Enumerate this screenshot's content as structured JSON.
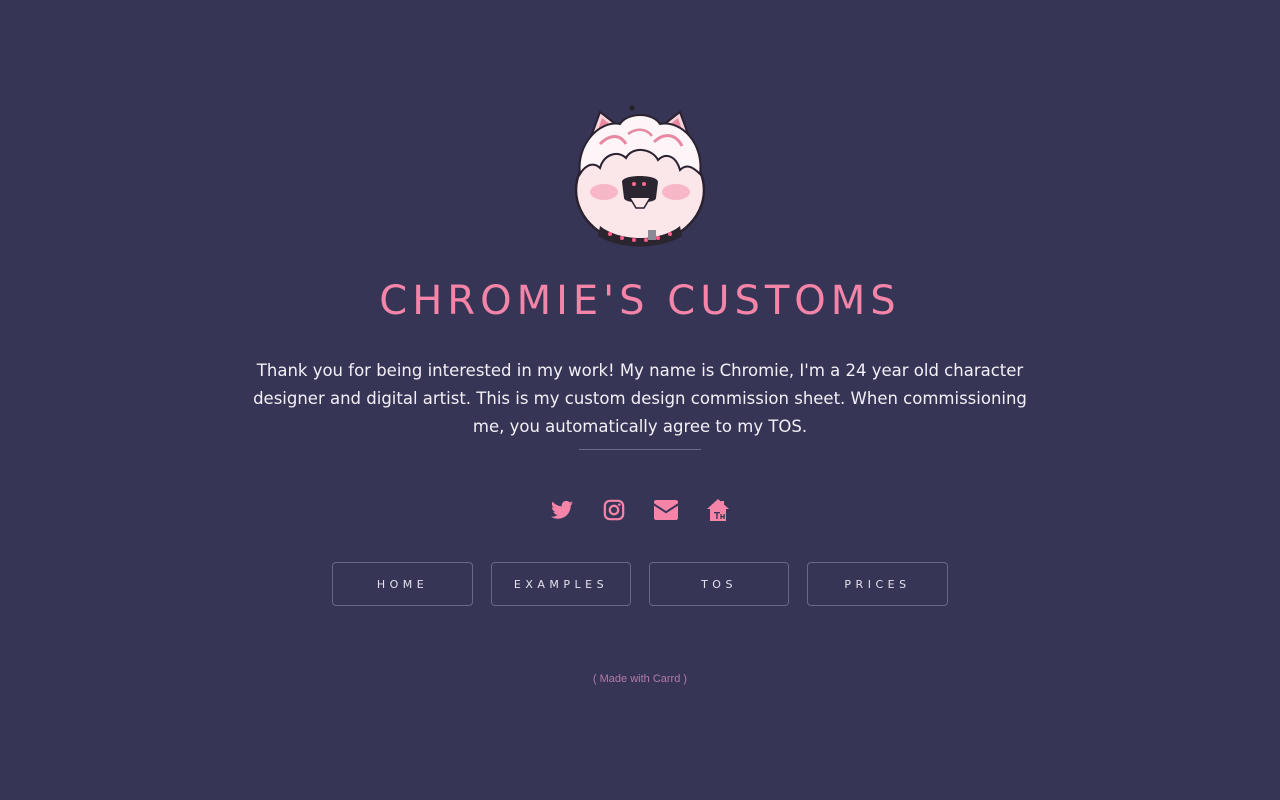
{
  "site": {
    "title": "CHROMIE'S CUSTOMS",
    "intro": "Thank you for being interested in my work! My name is Chromie, I'm a 24 year old character designer and digital artist. This is my custom design commission sheet. When commissioning me, you automatically agree to my TOS."
  },
  "social": [
    {
      "icon": "twitter-icon"
    },
    {
      "icon": "instagram-icon"
    },
    {
      "icon": "envelope-icon"
    },
    {
      "icon": "toyhouse-icon"
    }
  ],
  "nav": {
    "home": "HOME",
    "examples": "EXAMPLES",
    "tos": "TOS",
    "prices": "PRICES"
  },
  "footer": {
    "label": "( Made with Carrd )"
  },
  "colors": {
    "background": "#373556",
    "accent": "#f585a8",
    "text": "#f3eff7",
    "border": "#6a6888",
    "footer": "#b27aa6"
  }
}
